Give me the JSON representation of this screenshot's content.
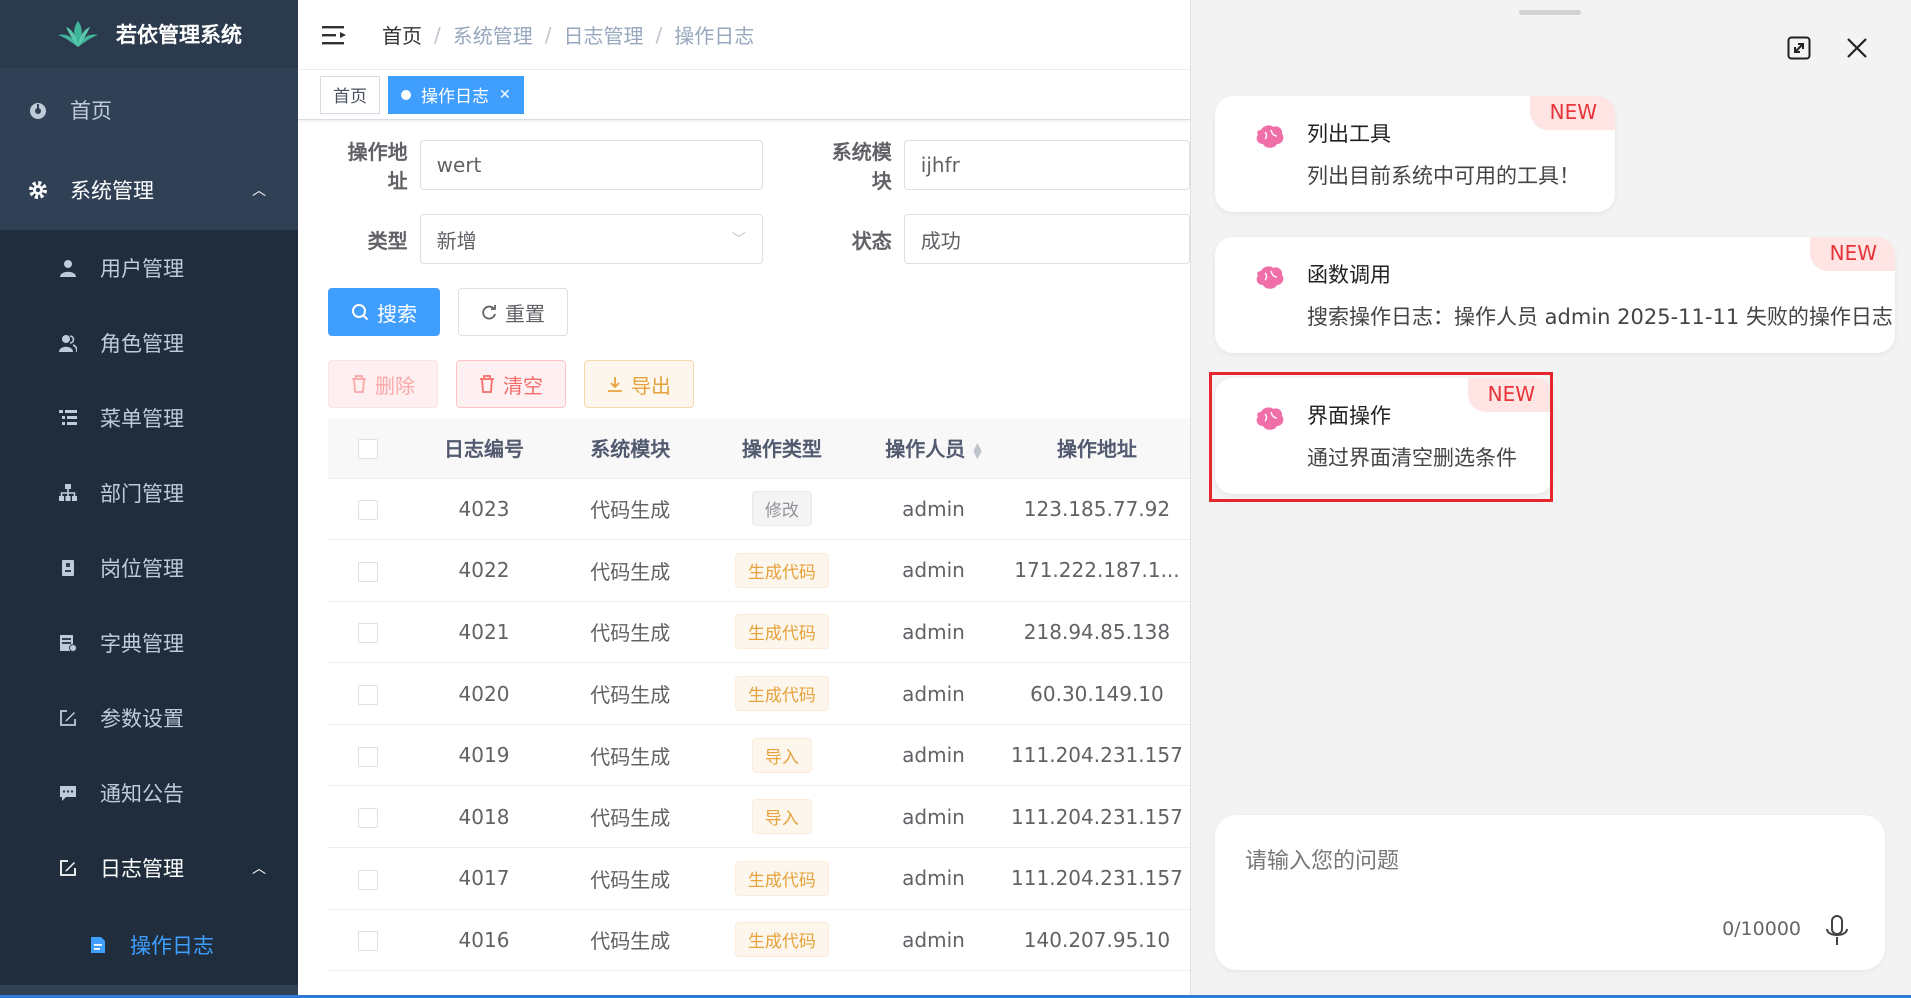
{
  "sidebar": {
    "logo_text": "若依管理系统",
    "home": "首页",
    "system_mgmt": "系统管理",
    "items": [
      "用户管理",
      "角色管理",
      "菜单管理",
      "部门管理",
      "岗位管理",
      "字典管理",
      "参数设置",
      "通知公告"
    ],
    "log_mgmt": "日志管理",
    "oper_log": "操作日志"
  },
  "breadcrumb": [
    "首页",
    "系统管理",
    "日志管理",
    "操作日志"
  ],
  "tags": {
    "home": "首页",
    "active": "操作日志"
  },
  "form": {
    "oper_url_label": "操作地址",
    "oper_url_value": "wert",
    "module_label": "系统模块",
    "module_value": "ijhfr",
    "type_label": "类型",
    "type_value": "新增",
    "status_label": "状态",
    "status_value": "成功"
  },
  "buttons": {
    "search": "搜索",
    "reset": "重置",
    "delete": "删除",
    "clear": "清空",
    "export": "导出"
  },
  "table": {
    "headers": [
      "日志编号",
      "系统模块",
      "操作类型",
      "操作人员",
      "操作地址"
    ],
    "rows": [
      {
        "id": "4023",
        "module": "代码生成",
        "type": "修改",
        "type_style": "info",
        "user": "admin",
        "ip": "123.185.77.92"
      },
      {
        "id": "4022",
        "module": "代码生成",
        "type": "生成代码",
        "type_style": "warning",
        "user": "admin",
        "ip": "171.222.187.1..."
      },
      {
        "id": "4021",
        "module": "代码生成",
        "type": "生成代码",
        "type_style": "warning",
        "user": "admin",
        "ip": "218.94.85.138"
      },
      {
        "id": "4020",
        "module": "代码生成",
        "type": "生成代码",
        "type_style": "warning",
        "user": "admin",
        "ip": "60.30.149.10"
      },
      {
        "id": "4019",
        "module": "代码生成",
        "type": "导入",
        "type_style": "warning",
        "user": "admin",
        "ip": "111.204.231.157"
      },
      {
        "id": "4018",
        "module": "代码生成",
        "type": "导入",
        "type_style": "warning",
        "user": "admin",
        "ip": "111.204.231.157"
      },
      {
        "id": "4017",
        "module": "代码生成",
        "type": "生成代码",
        "type_style": "warning",
        "user": "admin",
        "ip": "111.204.231.157"
      },
      {
        "id": "4016",
        "module": "代码生成",
        "type": "生成代码",
        "type_style": "warning",
        "user": "admin",
        "ip": "140.207.95.10"
      }
    ]
  },
  "panel": {
    "cards": [
      {
        "title": "列出工具",
        "desc": "列出目前系统中可用的工具！",
        "badge": "NEW"
      },
      {
        "title": "函数调用",
        "desc": "搜索操作日志：操作人员 admin 2025-11-11 失败的操作日志",
        "badge": "NEW"
      },
      {
        "title": "界面操作",
        "desc": "通过界面清空删选条件",
        "badge": "NEW"
      }
    ],
    "input_placeholder": "请输入您的问题",
    "char_count": "0/10000"
  },
  "colors": {
    "sidebar_bg": "#304156",
    "accent": "#409eff",
    "new_badge": "#e5343a",
    "highlight_border": "#e5262c"
  }
}
